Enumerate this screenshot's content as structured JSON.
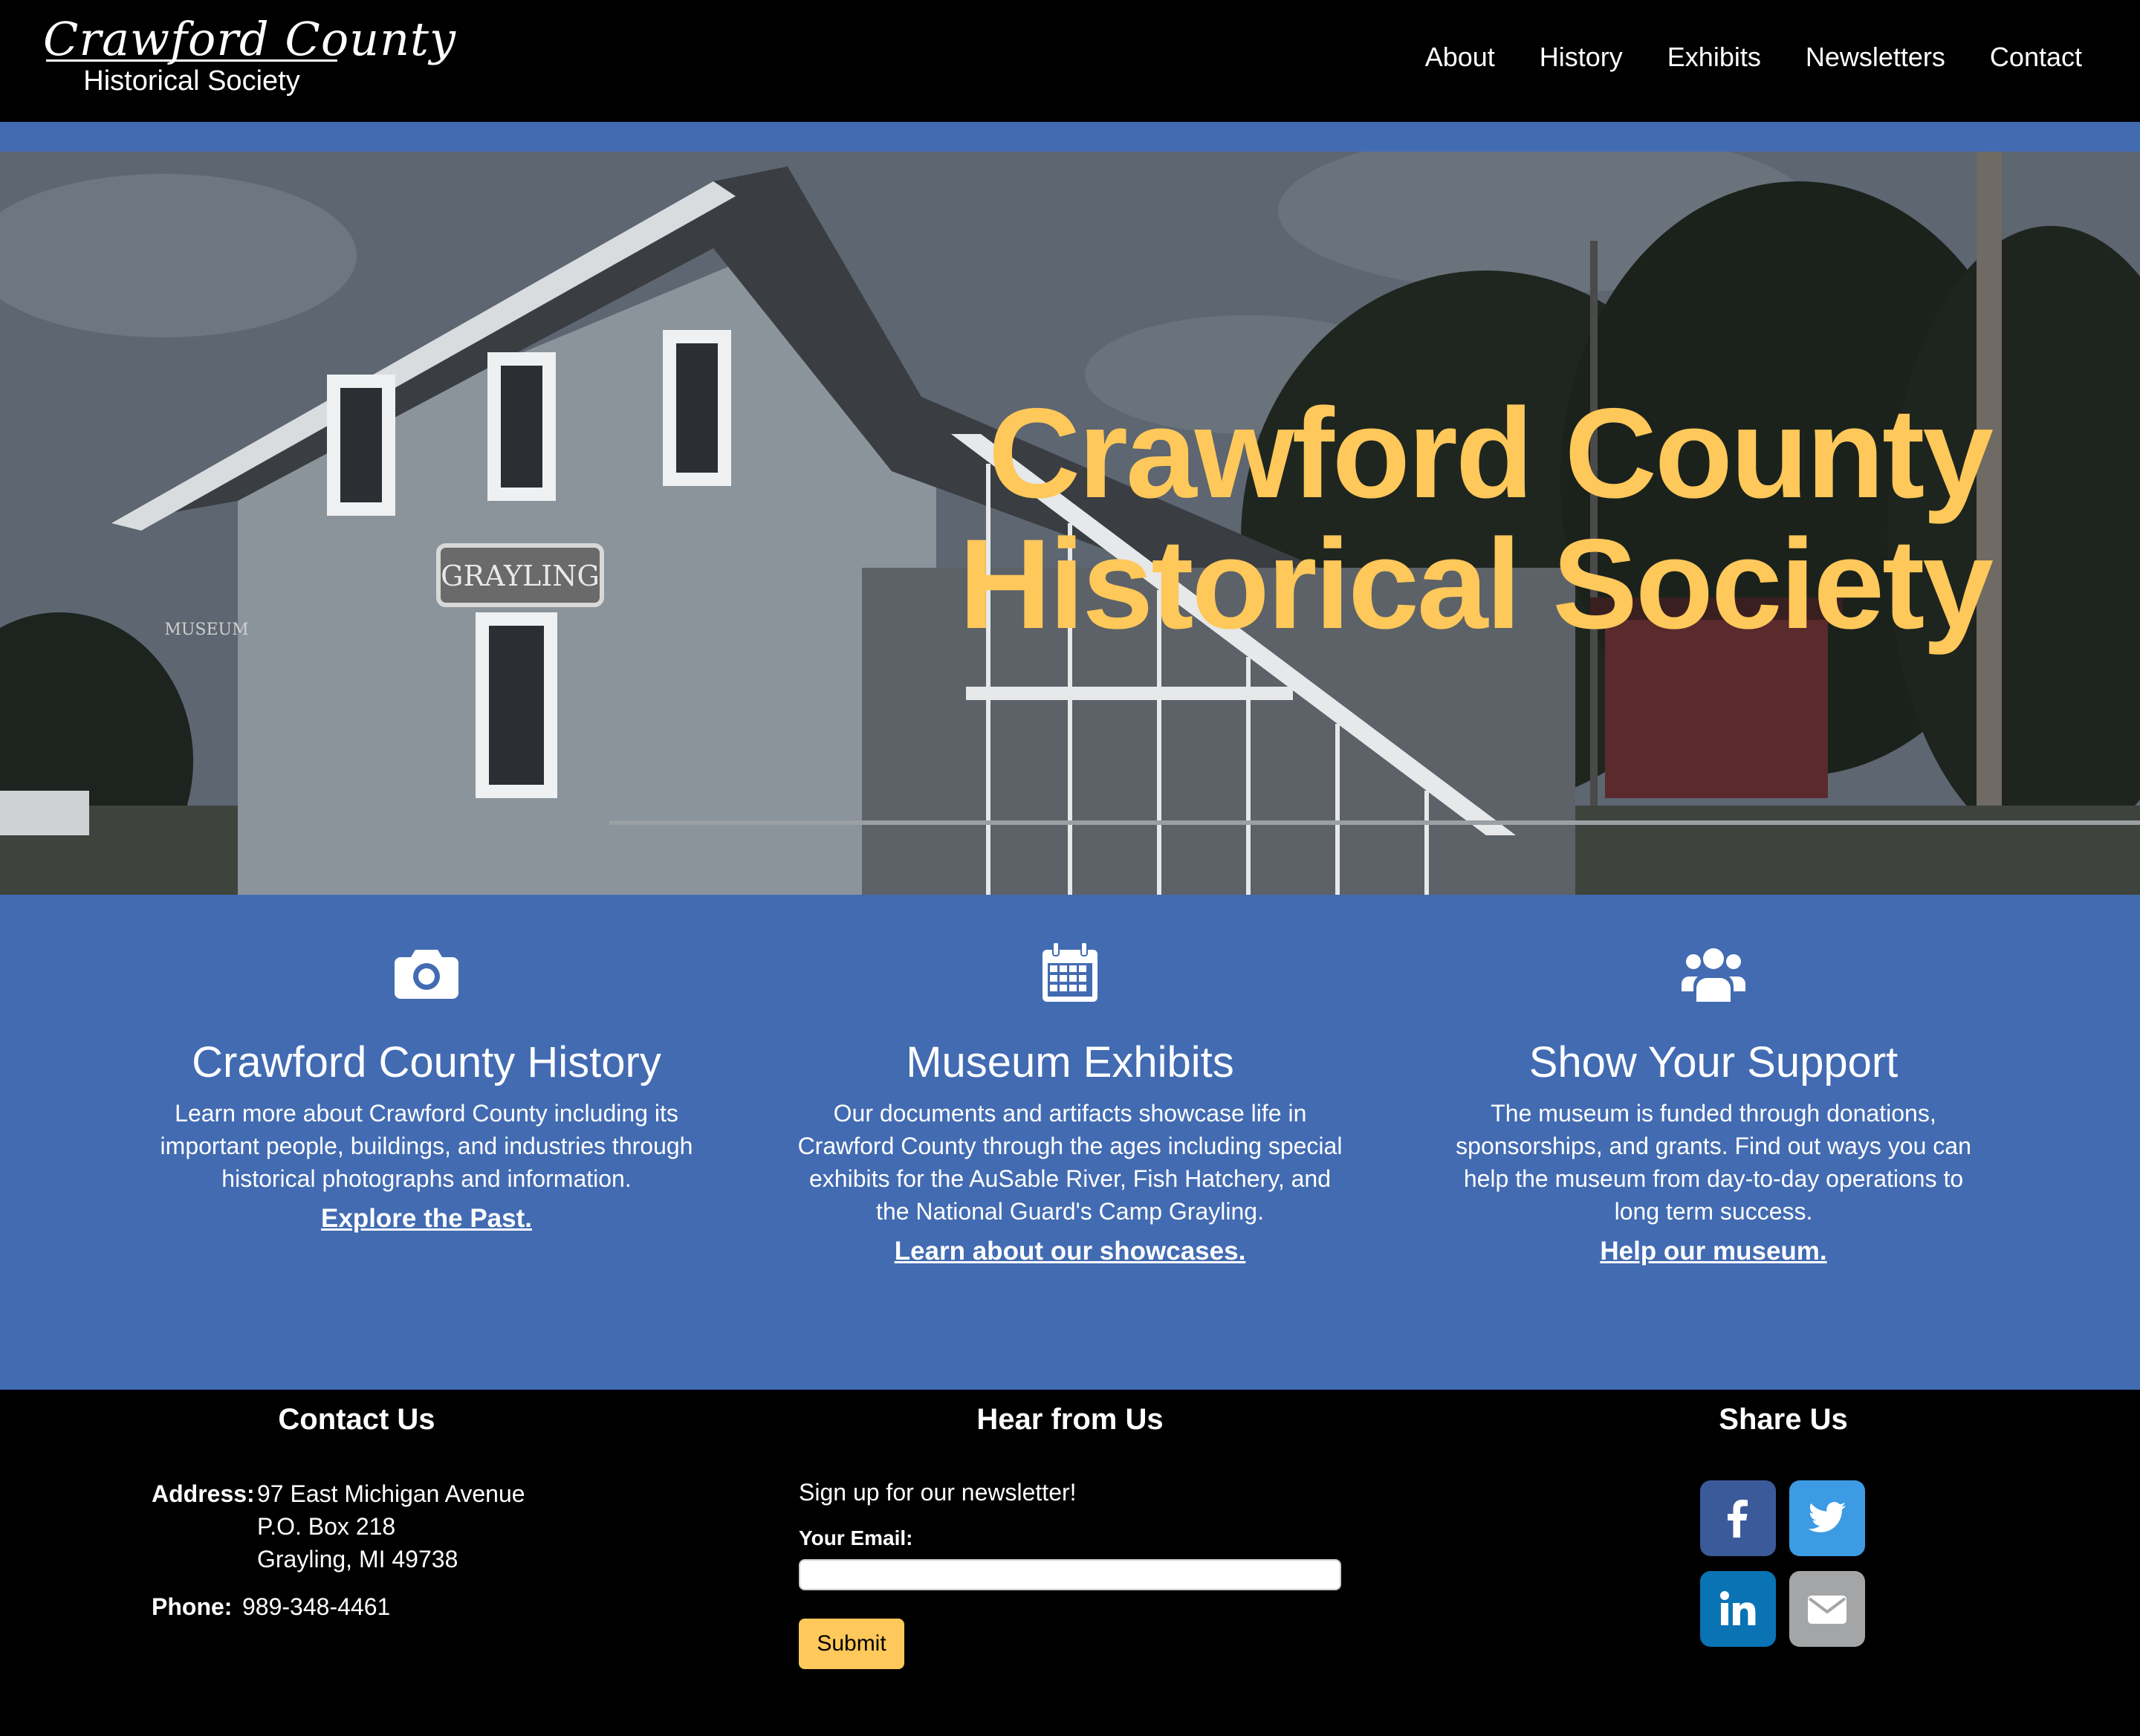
{
  "colors": {
    "accent_blue": "#426bb2",
    "gold": "#ffc85a",
    "facebook": "#3b5a9a",
    "twitter": "#3c9be3",
    "linkedin": "#0a73b3",
    "email_gray": "#a4a5a7"
  },
  "header": {
    "logo_script": "Crawford County",
    "logo_sub": "Historical Society",
    "nav": [
      "About",
      "History",
      "Exhibits",
      "Newsletters",
      "Contact"
    ]
  },
  "hero": {
    "title_line1": "Crawford County",
    "title_line2": "Historical Society",
    "photo_sign": "GRAYLING",
    "photo_sign_small": "MUSEUM"
  },
  "features": [
    {
      "icon": "camera-icon",
      "title": "Crawford County History",
      "text": "Learn more about Crawford County including its important people, buildings, and industries through historical photographs and information.",
      "link": "Explore the Past."
    },
    {
      "icon": "calendar-icon",
      "title": "Museum Exhibits",
      "text": "Our documents and artifacts showcase life in Crawford County through the ages including special exhibits for the AuSable River, Fish Hatchery, and the National Guard's Camp Grayling.",
      "link": "Learn about our showcases."
    },
    {
      "icon": "users-icon",
      "title": "Show Your Support",
      "text": "The museum is funded through donations, sponsorships, and grants. Find out ways you can help the museum from day-to-day operations to long term success.",
      "link": "Help our museum."
    }
  ],
  "footer": {
    "contact": {
      "heading": "Contact Us",
      "address_label": "Address:",
      "address_lines": [
        "97 East Michigan Avenue",
        "P.O. Box 218",
        "Grayling, MI 49738"
      ],
      "phone_label": "Phone:",
      "phone": "989-348-4461"
    },
    "newsletter": {
      "heading": "Hear from Us",
      "intro": "Sign up for our newsletter!",
      "email_label": "Your Email:",
      "email_value": "",
      "submit_label": "Submit"
    },
    "share": {
      "heading": "Share Us",
      "icons": [
        "facebook-icon",
        "twitter-icon",
        "linkedin-icon",
        "email-icon"
      ]
    }
  }
}
